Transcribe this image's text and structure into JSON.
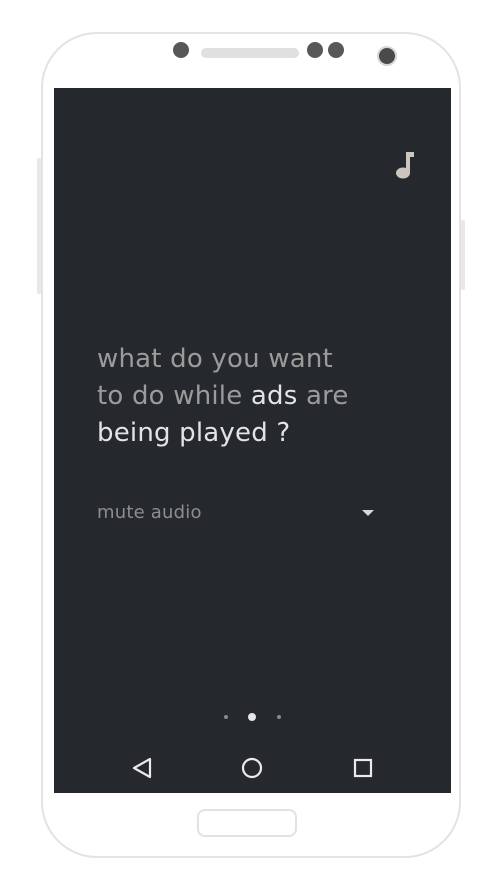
{
  "colors": {
    "screen_background": "#25292d",
    "text_dim": "#9b9b9b",
    "text_highlight": "#e3e3e3",
    "music_icon": "#cbc5bd",
    "device_frame": "#ffffff"
  },
  "header": {
    "icon": "music-note-icon"
  },
  "prompt": {
    "line1": "what do you want",
    "line2_part1": "to do while ",
    "line2_highlight": "ads",
    "line2_part2": " are",
    "line3": "being played ?"
  },
  "dropdown": {
    "selected": "mute audio",
    "icon": "caret-down-icon"
  },
  "pager": {
    "total": 3,
    "current": 2
  },
  "navbar": {
    "icons": [
      "back-triangle-icon",
      "home-circle-icon",
      "recents-square-icon"
    ]
  }
}
